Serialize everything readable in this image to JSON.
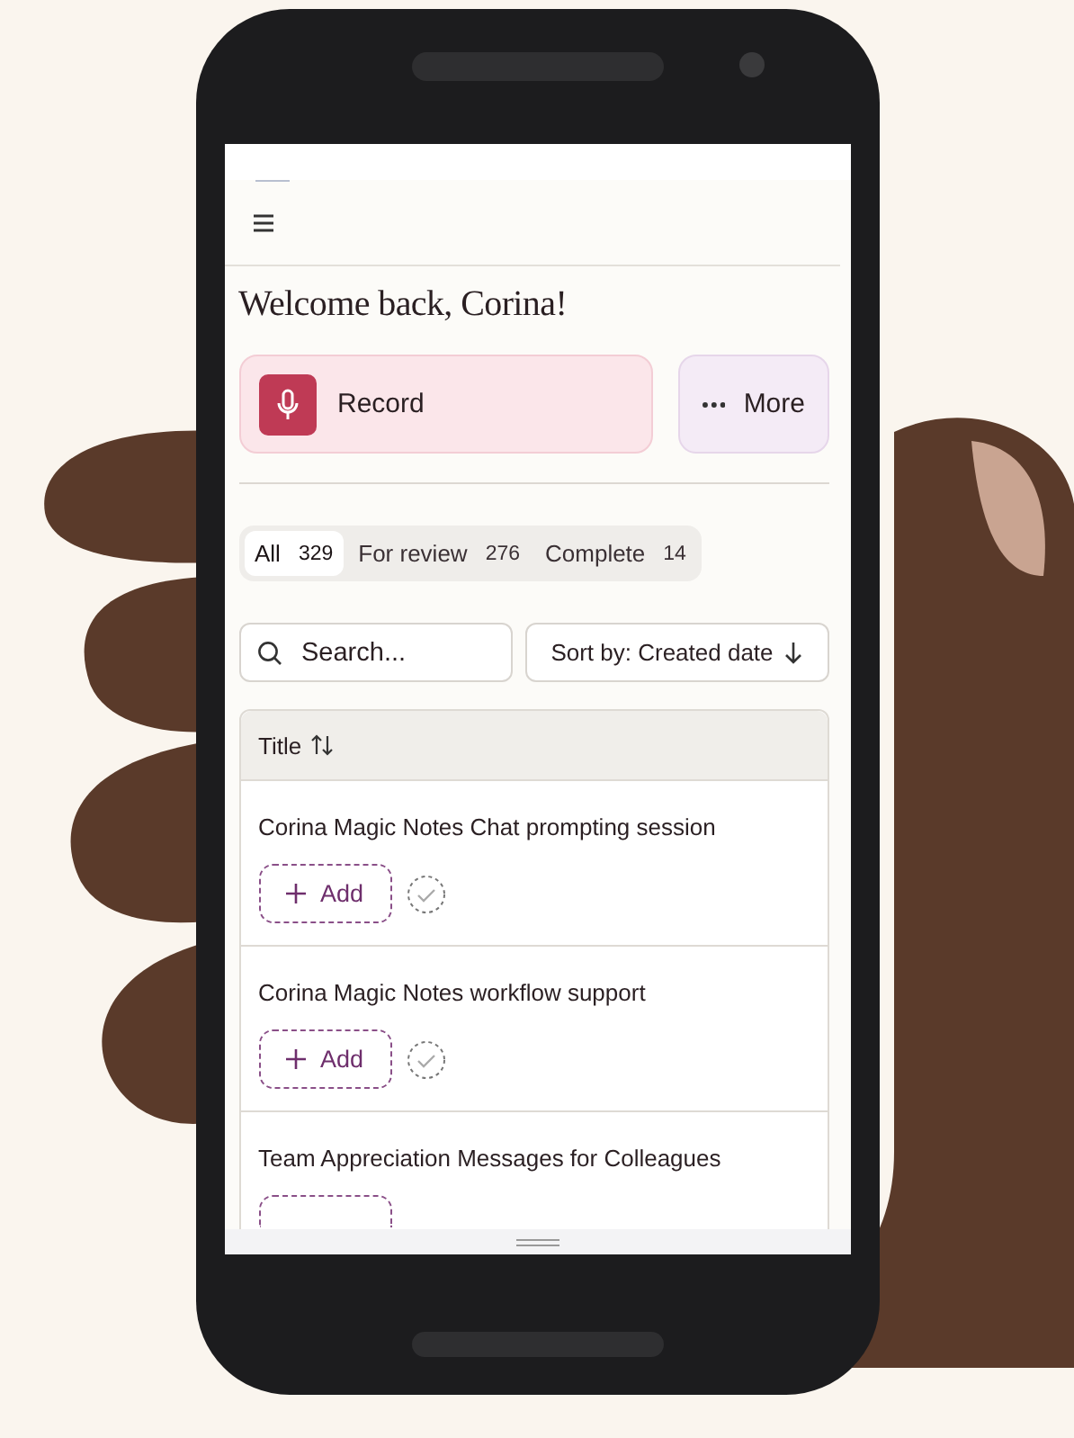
{
  "greeting": "Welcome back, Corina!",
  "actions": [
    {
      "kind": "record",
      "label": "Record"
    },
    {
      "kind": "more",
      "label": "More"
    }
  ],
  "tabs": [
    {
      "label": "All",
      "count": "329",
      "selected": true
    },
    {
      "label": "For review",
      "count": "276",
      "selected": false
    },
    {
      "label": "Complete",
      "count": "14",
      "selected": false
    }
  ],
  "search": {
    "placeholder": "Search..."
  },
  "sort": {
    "label": "Sort by: Created date"
  },
  "table": {
    "columns": [
      "Title"
    ],
    "rows": [
      {
        "title": "Corina Magic Notes Chat prompting session",
        "add_label": "Add"
      },
      {
        "title": "Corina Magic Notes workflow support",
        "add_label": "Add"
      },
      {
        "title": "Team Appreciation Messages for Colleagues"
      }
    ]
  }
}
